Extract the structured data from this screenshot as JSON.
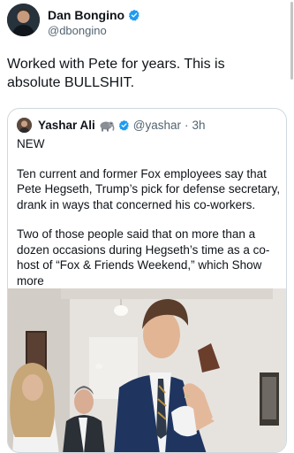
{
  "author": {
    "name": "Dan Bongino",
    "handle": "@dbongino"
  },
  "tweet": {
    "text": "Worked with Pete for years. This is absolute BULLSHIT."
  },
  "quoted": {
    "name": "Yashar Ali",
    "handle": "@yashar",
    "separator": "·",
    "time": "3h",
    "emoji": "elephant-emoji",
    "paragraphs": [
      "NEW",
      "Ten current and former Fox employees say that Pete Hegseth, Trump’s pick for defense secretary, drank in ways that concerned his co-workers.",
      "Two of those people said that on more than a dozen occasions during Hegseth’s time as a co-host of “Fox & Friends Weekend,” which Show more"
    ]
  },
  "colors": {
    "verified": "#1d9bf0",
    "text": "#0f1419",
    "muted": "#536471",
    "border": "#cfd9de"
  }
}
